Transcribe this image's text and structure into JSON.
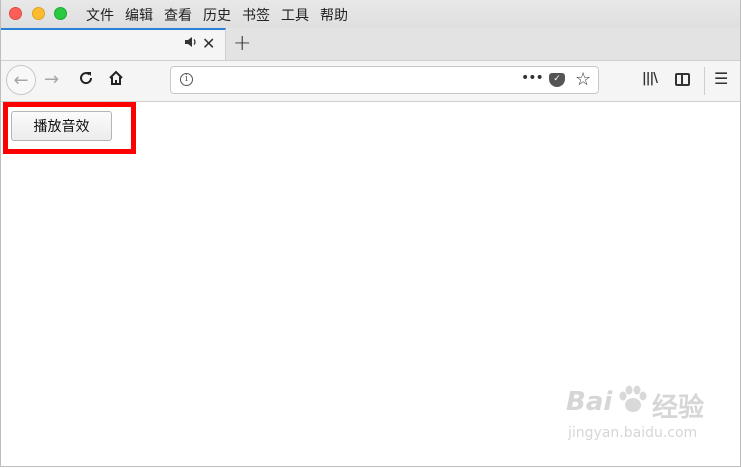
{
  "window": {
    "menu": [
      "文件",
      "编辑",
      "查看",
      "历史",
      "书签",
      "工具",
      "帮助"
    ]
  },
  "tab": {
    "audio_icon": "speaker-icon",
    "close_glyph": "✕",
    "new_tab_glyph": "+"
  },
  "nav": {
    "url_value": "",
    "url_placeholder": ""
  },
  "content": {
    "button_label": "播放音效",
    "highlight_color": "#ff0000"
  },
  "watermark": {
    "brand": "Bai",
    "brand_suffix": "经验",
    "url": "jingyan.baidu.com"
  }
}
